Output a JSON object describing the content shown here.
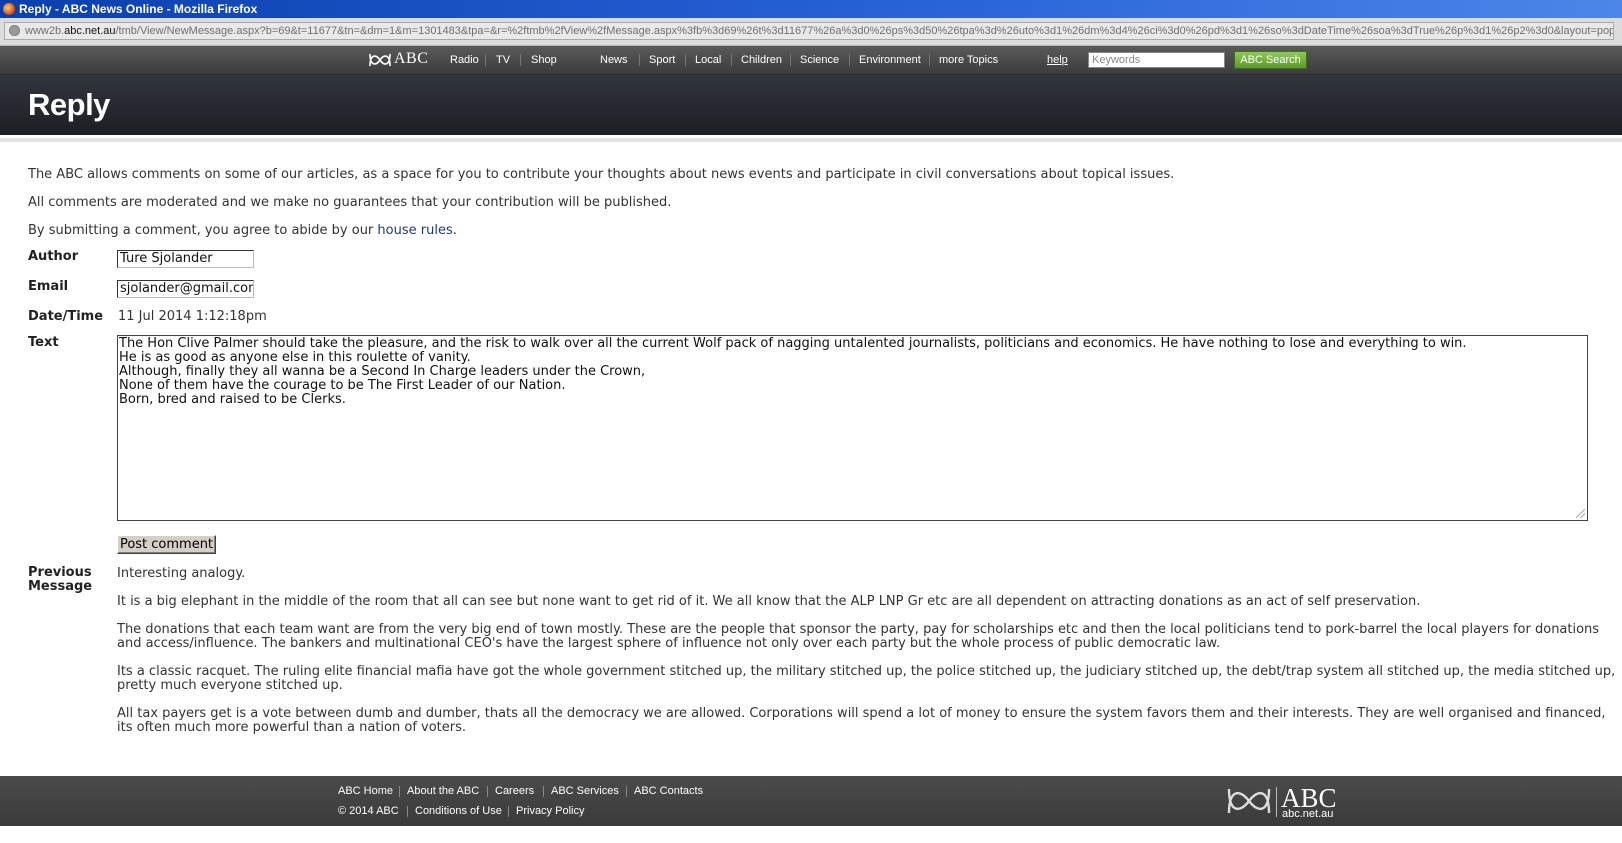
{
  "window": {
    "title": "Reply - ABC News Online - Mozilla Firefox",
    "url_prefix": "www2b.",
    "url_domain": "abc.net.au",
    "url_rest": "/tmb/View/NewMessage.aspx?b=69&t=11677&tn=&dm=1&m=1301483&tpa=&r=%2ftmb%2fView%2fMessage.aspx%3fb%3d69%26t%3d11677%26a%3d0%26ps%3d50%26tpa%3d%26uto%3d1%26dm%3d4%26ci%3d0%26pd%3d1%26so%3dDateTime%26soa%3dTrue%26p%3d1%26p2%3d0&layout=popup"
  },
  "nav": {
    "logo": "ABC",
    "links": [
      "Radio",
      "TV",
      "Shop",
      "News",
      "Sport",
      "Local",
      "Children",
      "Science",
      "Environment",
      "more Topics"
    ],
    "help": "help",
    "search_placeholder": "Keywords",
    "search_button": "ABC Search"
  },
  "page": {
    "title": "Reply",
    "intro": [
      "The ABC allows comments on some of our articles, as a space for you to contribute your thoughts about news events and participate in civil conversations about topical issues.",
      "All comments are moderated and we make no guarantees that your contribution will be published."
    ],
    "rules_prefix": "By submitting a comment, you agree to abide by our ",
    "rules_link": "house rules",
    "rules_suffix": "."
  },
  "form": {
    "author_label": "Author",
    "author_value": "Ture Sjolander",
    "email_label": "Email",
    "email_value": "sjolander@gmail.com",
    "datetime_label": "Date/Time",
    "datetime_value": "11 Jul 2014 1:12:18pm",
    "text_label": "Text",
    "text_lines": [
      "The Hon Clive Palmer should take the pleasure, and the risk to walk over all the current Wolf pack of nagging untalented journalists, politicians and economics. He have nothing to lose and everything to win.",
      "He is as good as anyone else in this roulette of vanity.",
      "Although, finally they all wanna be a Second In Charge leaders under the Crown,",
      "None of them have the courage to be The First Leader of our Nation.",
      "Born, bred and raised to be Clerks."
    ],
    "post_button": "Post comment"
  },
  "previous": {
    "label_line1": "Previous",
    "label_line2": "Message",
    "paragraphs": [
      "Interesting analogy.",
      "It is a big elephant in the middle of the room that all can see but none want to get rid of it. We all know that the ALP LNP Gr etc are all dependent on attracting donations as an act of self preservation.",
      "The donations that each team want are from the very big end of town mostly. These are the people that sponsor the party, pay for scholarships etc and then the local politicians tend to pork-barrel the local players for donations and access/influence. The bankers and multinational CEO's have the largest sphere of influence not only over each party but the whole process of public democratic law.",
      "Its a classic racquet. The ruling elite financial mafia have got the whole government stitched up, the military stitched up, the police stitched up, the judiciary stitched up, the debt/trap system all stitched up, the media stitched up, pretty much everyone stitched up.",
      "All tax payers get is a vote between dumb and dumber, thats all the democracy we are allowed. Corporations will spend a lot of money to ensure the system favors them and their interests. They are well organised and financed, its often much more powerful than a nation of voters."
    ]
  },
  "footer": {
    "links": [
      "ABC Home",
      "About the ABC",
      "Careers",
      "ABC Services",
      "ABC Contacts"
    ],
    "copyright": "© 2014 ABC",
    "links2": [
      "Conditions of Use",
      "Privacy Policy"
    ],
    "logo": "ABC",
    "domain": "abc.net.au"
  },
  "colors": {
    "titlebar": "#0a3fae",
    "navbar": "#4a4a4a",
    "header": "#25292f",
    "search_button": "#6aa83a",
    "link": "#1f3b73"
  }
}
